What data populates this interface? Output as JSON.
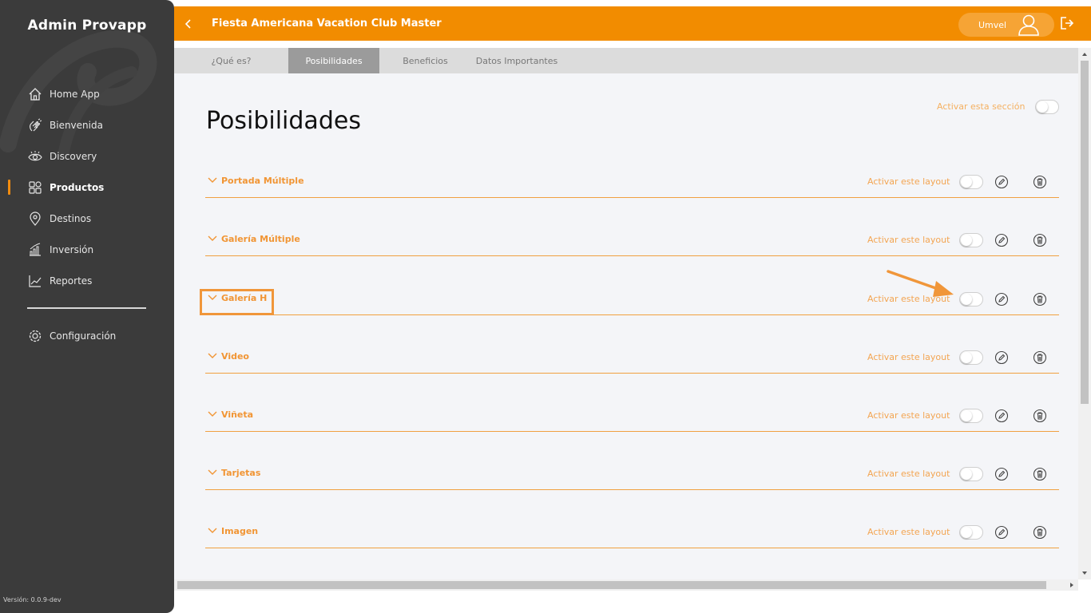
{
  "sidebar": {
    "brand": "Admin Provapp",
    "items": [
      {
        "label": "Home App",
        "icon": "home-icon"
      },
      {
        "label": "Bienvenida",
        "icon": "wave-hand-icon"
      },
      {
        "label": "Discovery",
        "icon": "eye-icon"
      },
      {
        "label": "Productos",
        "icon": "grid-icon",
        "active": true
      },
      {
        "label": "Destinos",
        "icon": "location-pin-icon"
      },
      {
        "label": "Inversión",
        "icon": "bar-chart-icon"
      },
      {
        "label": "Reportes",
        "icon": "line-chart-icon"
      }
    ],
    "settings_label": "Configuración",
    "version": "Versión: 0.0.9-dev"
  },
  "header": {
    "title": "Fiesta Americana Vacation Club Master",
    "user_name": "Umvel"
  },
  "tabs": [
    {
      "label": "¿Qué es?"
    },
    {
      "label": "Posibilidades",
      "active": true
    },
    {
      "label": "Beneficios"
    },
    {
      "label": "Datos Importantes"
    }
  ],
  "main": {
    "title": "Posibilidades",
    "section_toggle_label": "Activar esta sección",
    "layout_toggle_label": "Activar este layout",
    "layouts": [
      {
        "name": "Portada Múltiple"
      },
      {
        "name": "Galería Múltiple"
      },
      {
        "name": "Galería H"
      },
      {
        "name": "Video"
      },
      {
        "name": "Viñeta"
      },
      {
        "name": "Tarjetas"
      },
      {
        "name": "Imagen"
      }
    ]
  },
  "colors": {
    "accent": "#f28c00",
    "sidebar_bg": "#3b3b3b",
    "content_bg": "#f4f5f8"
  }
}
